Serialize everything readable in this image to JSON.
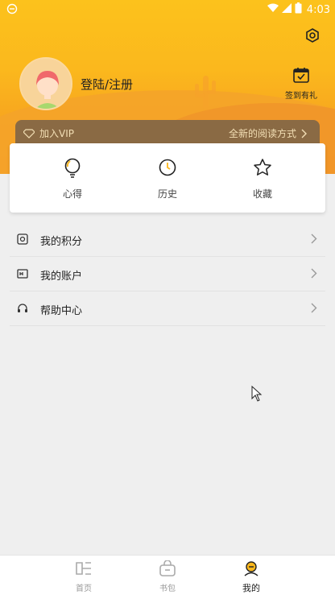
{
  "status_bar": {
    "time": "4:03"
  },
  "profile": {
    "login_text": "登陆/注册"
  },
  "signin": {
    "label": "签到有礼"
  },
  "vip": {
    "join_label": "加入VIP",
    "promo_label": "全新的阅读方式"
  },
  "quick_actions": [
    {
      "label": "心得",
      "icon": "bulb-icon"
    },
    {
      "label": "历史",
      "icon": "clock-icon"
    },
    {
      "label": "收藏",
      "icon": "star-icon"
    }
  ],
  "menu": [
    {
      "label": "我的积分",
      "icon": "points-icon"
    },
    {
      "label": "我的账户",
      "icon": "account-icon"
    },
    {
      "label": "帮助中心",
      "icon": "headset-icon"
    }
  ],
  "tabs": [
    {
      "label": "首页",
      "icon": "home-icon"
    },
    {
      "label": "书包",
      "icon": "bag-icon"
    },
    {
      "label": "我的",
      "icon": "user-icon"
    }
  ],
  "colors": {
    "accent": "#fbb81d",
    "vip_bar": "#8a6a44",
    "vip_text": "#f3dfb5"
  }
}
